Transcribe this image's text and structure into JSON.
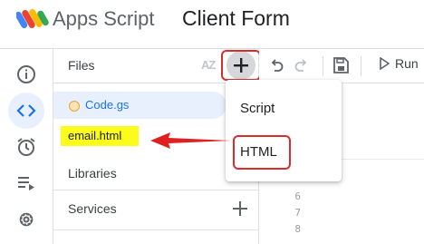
{
  "header": {
    "app_name": "Apps Script",
    "project_title": "Client Form"
  },
  "rail": {
    "items": [
      {
        "icon": "info-icon"
      },
      {
        "icon": "code-icon",
        "active": true
      },
      {
        "icon": "alarm-clock-icon"
      },
      {
        "icon": "playlist-executions-icon"
      },
      {
        "icon": "gear-icon"
      }
    ]
  },
  "files_panel": {
    "title": "Files",
    "sort_label": "AZ",
    "files": [
      {
        "name": "Code.gs",
        "selected": true
      },
      {
        "name": "email.html",
        "highlighted": true
      }
    ],
    "libraries_label": "Libraries",
    "services_label": "Services"
  },
  "toolbar": {
    "run_label": "Run"
  },
  "new_file_menu": {
    "items": [
      "Script",
      "HTML"
    ]
  },
  "editor": {
    "line_numbers": [
      "6",
      "7",
      "8"
    ]
  },
  "colors": {
    "accent_blue": "#1a73e8",
    "annotation_red": "#d92d2d",
    "highlight_yellow": "#fbfb1c"
  }
}
